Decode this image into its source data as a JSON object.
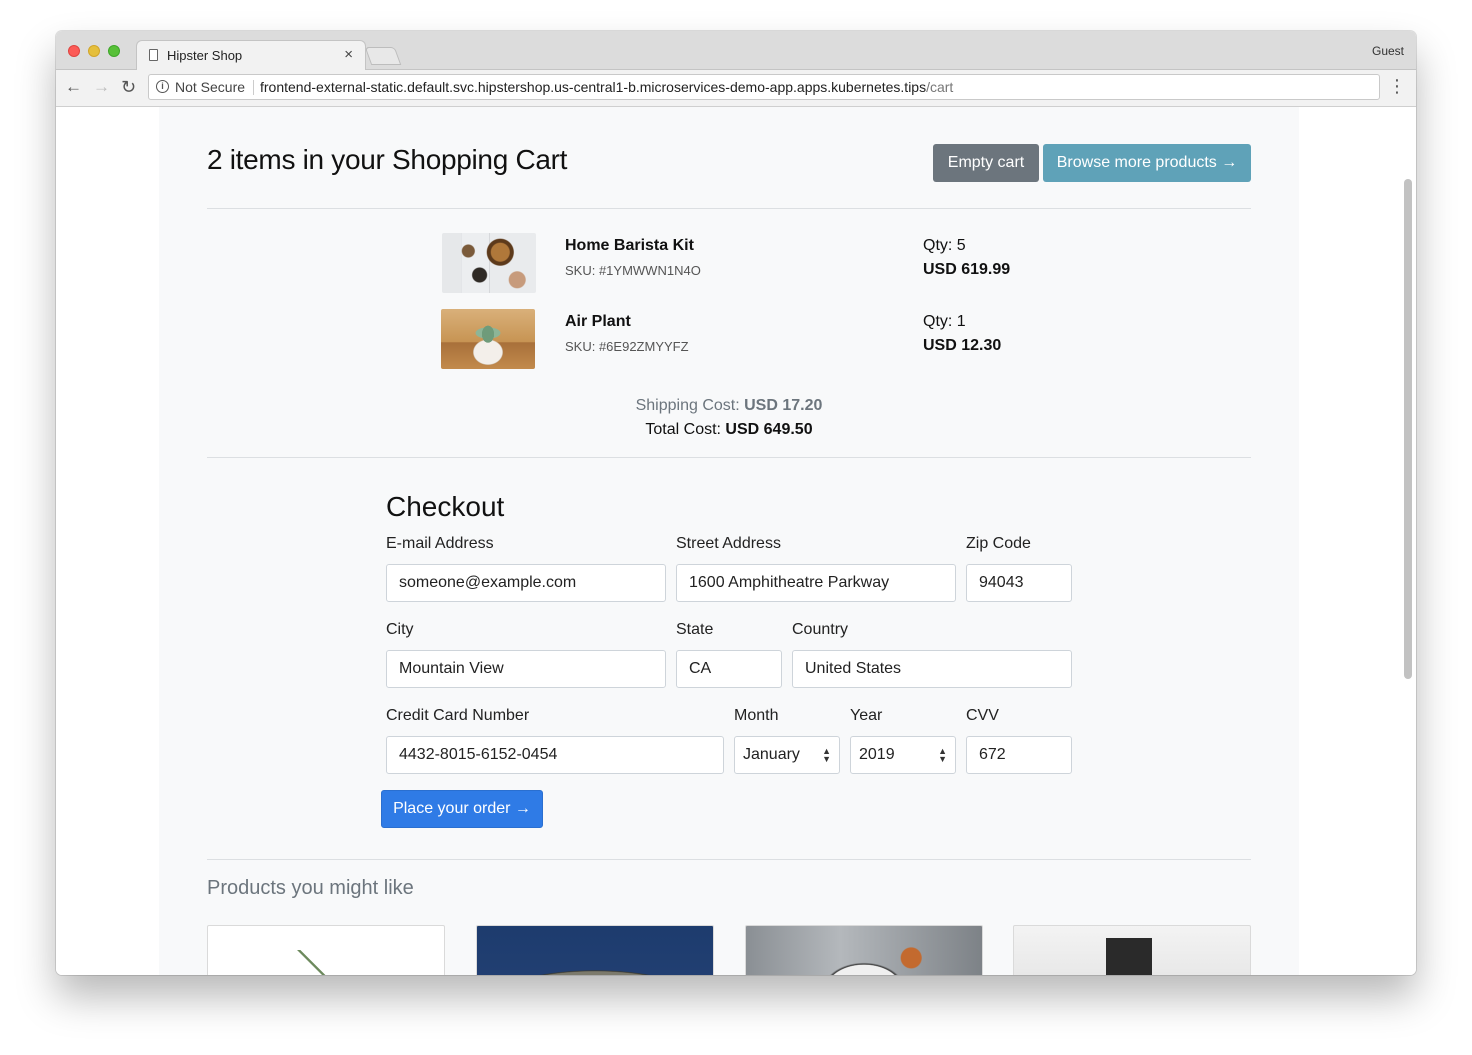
{
  "browser": {
    "tab_title": "Hipster Shop",
    "tab_close": "×",
    "profile": "Guest",
    "security_label": "Not Secure",
    "url_host": "frontend-external-static.default.svc.hipstershop.us-central1-b.microservices-demo-app.apps.kubernetes.tips",
    "url_path": "/cart",
    "icons": {
      "back": "←",
      "forward": "→",
      "reload": "↻",
      "menu": "⋮",
      "info": "i"
    }
  },
  "cart": {
    "title": "2 items in your Shopping Cart",
    "empty_button": "Empty cart",
    "browse_button": "Browse more products →",
    "items": [
      {
        "name": "Home Barista Kit",
        "sku": "SKU: #1YMWWN1N4O",
        "qty": "Qty: 5",
        "price": "USD 619.99",
        "image": "home-barista-kit-image"
      },
      {
        "name": "Air Plant",
        "sku": "SKU: #6E92ZMYYFZ",
        "qty": "Qty: 1",
        "price": "USD 12.30",
        "image": "air-plant-image"
      }
    ],
    "shipping_label": "Shipping Cost: ",
    "shipping_value": "USD 17.20",
    "total_label": "Total Cost: ",
    "total_value": "USD 649.50"
  },
  "checkout": {
    "title": "Checkout",
    "email": {
      "label": "E-mail Address",
      "value": "someone@example.com"
    },
    "street": {
      "label": "Street Address",
      "value": "1600 Amphitheatre Parkway"
    },
    "zip": {
      "label": "Zip Code",
      "value": "94043"
    },
    "city": {
      "label": "City",
      "value": "Mountain View"
    },
    "state": {
      "label": "State",
      "value": "CA"
    },
    "country": {
      "label": "Country",
      "value": "United States"
    },
    "card": {
      "label": "Credit Card Number",
      "value": "4432-8015-6152-0454"
    },
    "month": {
      "label": "Month",
      "value": "January"
    },
    "year": {
      "label": "Year",
      "value": "2019"
    },
    "cvv": {
      "label": "CVV",
      "value": "672"
    },
    "submit": "Place your order →"
  },
  "recommendations": {
    "title": "Products you might like",
    "items": [
      "plant-product-image",
      "record-player-product-image",
      "mug-product-image",
      "camera-product-image"
    ]
  },
  "colors": {
    "empty_button": "#6c757d",
    "browse_button": "#5fa2b8",
    "order_button": "#2f7be6",
    "content_bg": "#f8f9fa"
  }
}
